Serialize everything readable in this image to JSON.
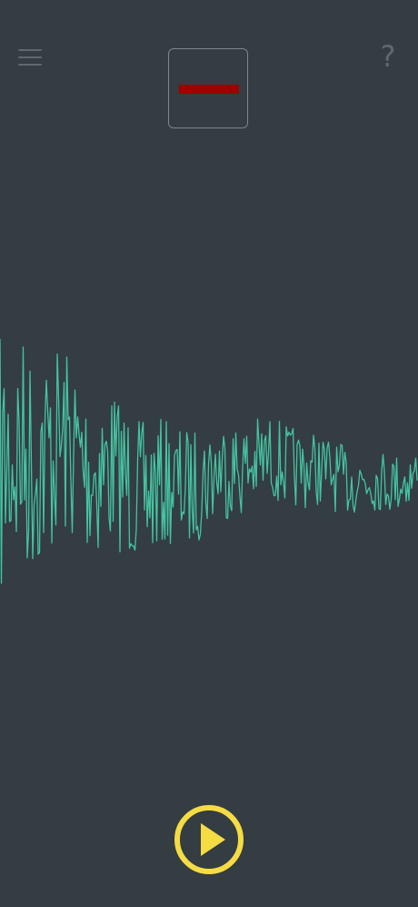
{
  "colors": {
    "background": "#333d42",
    "waveform": "#45c3a0",
    "accent": "#f5dc44",
    "indicator": "#a10000",
    "icon_muted": "#5e686d",
    "box_border": "#7c868b"
  },
  "toolbar": {
    "menu_icon": "hamburger-menu-icon",
    "indicator_icon": "dash-icon",
    "help_label": "?"
  },
  "player": {
    "play_icon": "play-icon"
  }
}
